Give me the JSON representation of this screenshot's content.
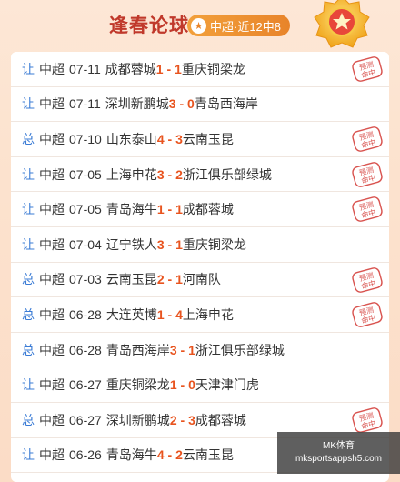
{
  "header": {
    "title": "逢春论球",
    "badge_label": "中超·近12中8",
    "badge_icon": "star-icon",
    "medal_icon": "star-medal-icon"
  },
  "stamp_text": "预测命中",
  "colors": {
    "accent": "#e8541f",
    "type_blue": "#3a7bd5",
    "title_red": "#c0392b",
    "stamp_red": "#d9534f"
  },
  "rows": [
    {
      "type": "让",
      "league": "中超",
      "date": "07-11",
      "home": "成都蓉城",
      "home_score": "1",
      "away_score": "1",
      "away": "重庆铜梁龙",
      "hit": true
    },
    {
      "type": "让",
      "league": "中超",
      "date": "07-11",
      "home": "深圳新鹏城",
      "home_score": "3",
      "away_score": "0",
      "away": "青岛西海岸",
      "hit": false
    },
    {
      "type": "总",
      "league": "中超",
      "date": "07-10",
      "home": "山东泰山",
      "home_score": "4",
      "away_score": "3",
      "away": "云南玉昆",
      "hit": true
    },
    {
      "type": "让",
      "league": "中超",
      "date": "07-05",
      "home": "上海申花",
      "home_score": "3",
      "away_score": "2",
      "away": "浙江俱乐部绿城",
      "hit": true
    },
    {
      "type": "让",
      "league": "中超",
      "date": "07-05",
      "home": "青岛海牛",
      "home_score": "1",
      "away_score": "1",
      "away": "成都蓉城",
      "hit": true
    },
    {
      "type": "让",
      "league": "中超",
      "date": "07-04",
      "home": "辽宁铁人",
      "home_score": "3",
      "away_score": "1",
      "away": "重庆铜梁龙",
      "hit": false
    },
    {
      "type": "总",
      "league": "中超",
      "date": "07-03",
      "home": "云南玉昆",
      "home_score": "2",
      "away_score": "1",
      "away": "河南队",
      "hit": true
    },
    {
      "type": "总",
      "league": "中超",
      "date": "06-28",
      "home": "大连英博",
      "home_score": "1",
      "away_score": "4",
      "away": "上海申花",
      "hit": true
    },
    {
      "type": "总",
      "league": "中超",
      "date": "06-28",
      "home": "青岛西海岸",
      "home_score": "3",
      "away_score": "1",
      "away": "浙江俱乐部绿城",
      "hit": false
    },
    {
      "type": "让",
      "league": "中超",
      "date": "06-27",
      "home": "重庆铜梁龙",
      "home_score": "1",
      "away_score": "0",
      "away": "天津津门虎",
      "hit": false
    },
    {
      "type": "总",
      "league": "中超",
      "date": "06-27",
      "home": "深圳新鹏城",
      "home_score": "2",
      "away_score": "3",
      "away": "成都蓉城",
      "hit": true
    },
    {
      "type": "让",
      "league": "中超",
      "date": "06-26",
      "home": "青岛海牛",
      "home_score": "4",
      "away_score": "2",
      "away": "云南玉昆",
      "hit": false
    }
  ],
  "watermark": {
    "line1": "MK体育",
    "line2": "mksportsappsh5.com"
  }
}
